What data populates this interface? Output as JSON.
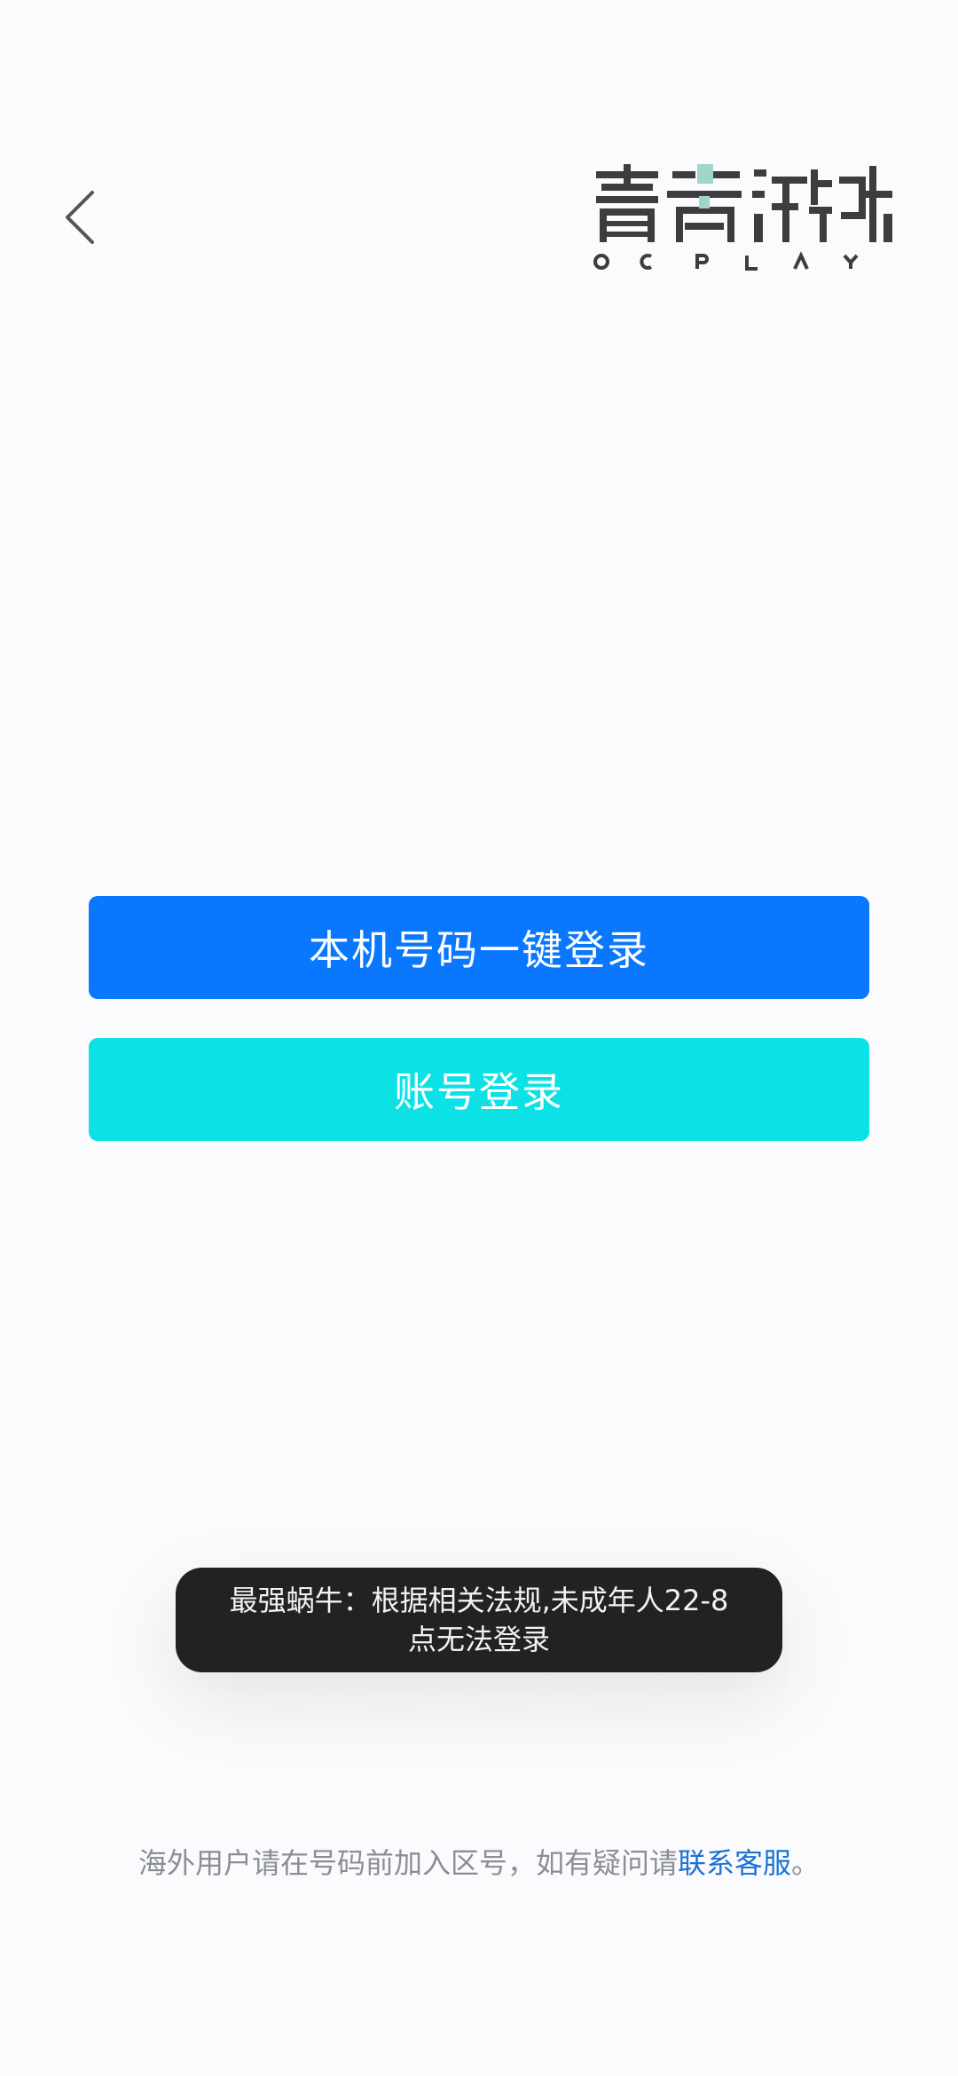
{
  "header": {
    "logo_text": "青瓷游戏",
    "logo_subtext": "QCPLAY"
  },
  "buttons": {
    "one_click_login": "本机号码一键登录",
    "account_login": "账号登录"
  },
  "toast": {
    "line1": "最强蜗牛：根据相关法规,未成年人22-8",
    "line2": "点无法登录"
  },
  "footer": {
    "text": "海外用户请在号码前加入区号，如有疑问请",
    "link": "联系客服",
    "suffix": "。"
  },
  "colors": {
    "primary": "#0a78fe",
    "secondary": "#0ce2e6",
    "link": "#1a73d6",
    "toast_bg": "#222224",
    "logo_dark": "#3d3d3f",
    "logo_accent": "#9ed6c8"
  },
  "icons": {
    "back": "chevron-left-icon"
  }
}
